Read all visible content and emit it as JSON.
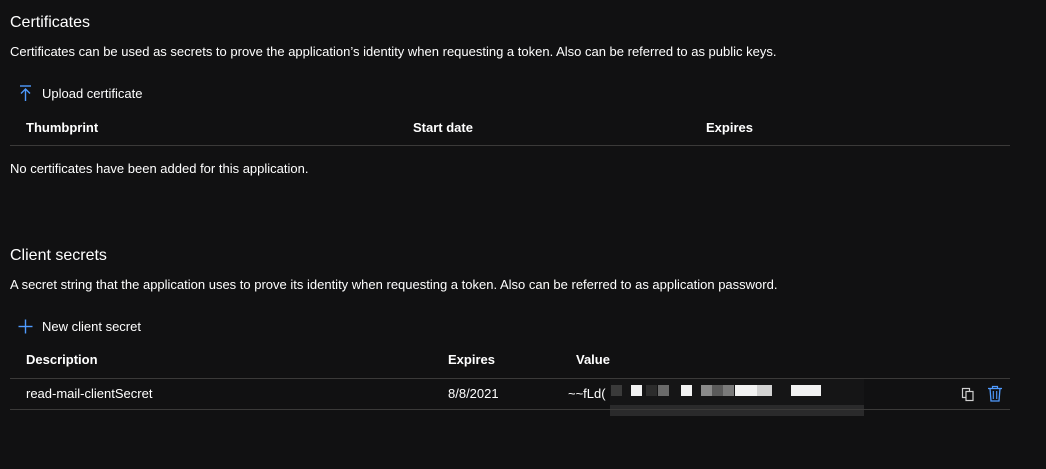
{
  "certificates": {
    "title": "Certificates",
    "description": "Certificates can be used as secrets to prove the application’s identity when requesting a token. Also can be referred to as public keys.",
    "upload_label": "Upload certificate",
    "columns": [
      "Thumbprint",
      "Start date",
      "Expires"
    ],
    "empty_message": "No certificates have been added for this application."
  },
  "client_secrets": {
    "title": "Client secrets",
    "description": "A secret string that the application uses to prove its identity when requesting a token. Also can be referred to as application password.",
    "new_label": "New client secret",
    "columns": [
      "Description",
      "Expires",
      "Value"
    ],
    "rows": [
      {
        "description": "read-mail-clientSecret",
        "expires": "8/8/2021",
        "value_visible": "~~fLd("
      }
    ]
  },
  "colors": {
    "background": "#111112",
    "accent": "#4f9bff",
    "divider": "#3b3a39"
  },
  "icons": {
    "upload": "upload-arrow-icon",
    "add": "plus-icon",
    "copy": "copy-icon",
    "delete": "trash-icon"
  }
}
